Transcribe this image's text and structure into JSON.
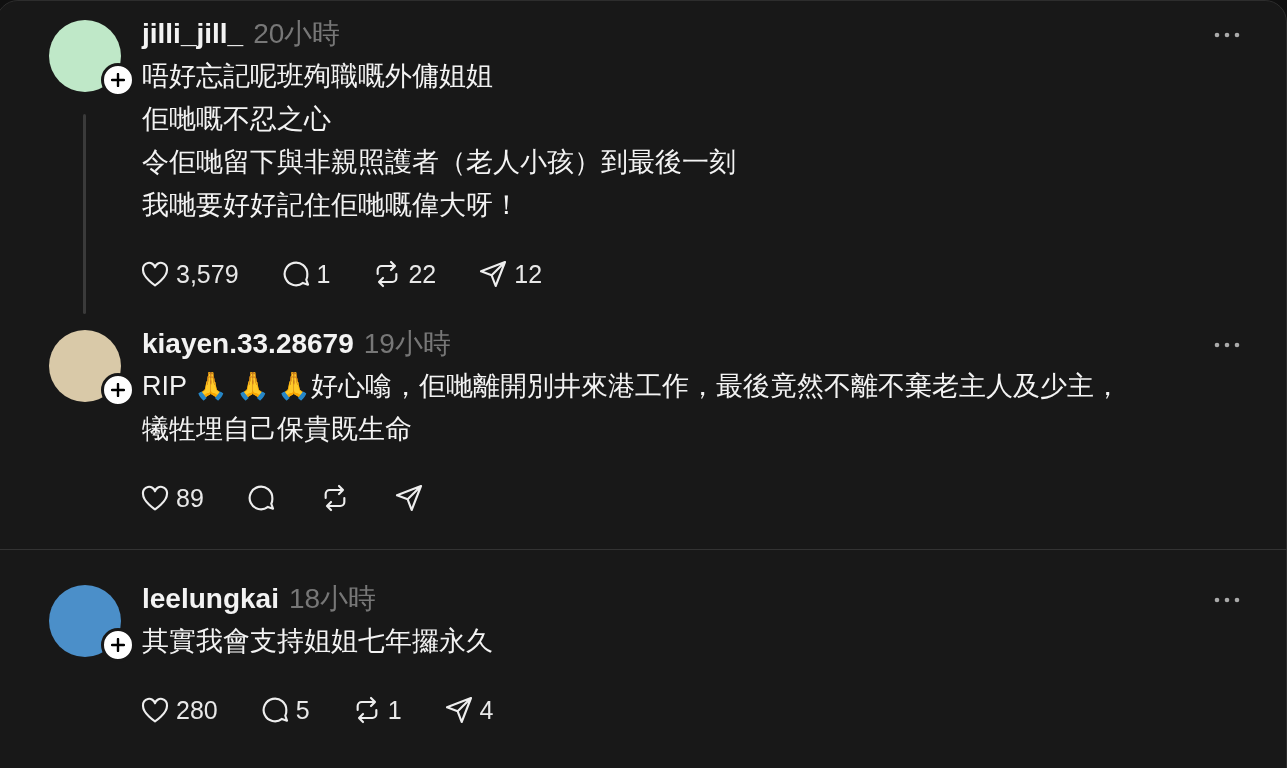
{
  "posts": [
    {
      "username": "jilli_jill_",
      "time": "20小時",
      "thread_line": true,
      "divider_below": false,
      "lines": [
        "唔好忘記呢班殉職嘅外傭姐姐",
        "佢哋嘅不忍之心",
        "令佢哋留下與非親照護者（老人小孩）到最後一刻",
        "我哋要好好記住佢哋嘅偉大呀！"
      ],
      "actions": [
        {
          "kind": "like",
          "count": "3,579"
        },
        {
          "kind": "reply",
          "count": "1"
        },
        {
          "kind": "repost",
          "count": "22"
        },
        {
          "kind": "share",
          "count": "12"
        }
      ]
    },
    {
      "username": "kiayen.33.28679",
      "time": "19小時",
      "thread_line": false,
      "divider_below": true,
      "lines": [
        "RIP 🙏 🙏 🙏好心噏，佢哋離開別井來港工作，最後竟然不離不棄老主人及少主，",
        "犧牲埋自己保貴既生命"
      ],
      "actions": [
        {
          "kind": "like",
          "count": "89"
        },
        {
          "kind": "reply"
        },
        {
          "kind": "repost"
        },
        {
          "kind": "share"
        }
      ]
    },
    {
      "username": "leelungkai",
      "time": "18小時",
      "thread_line": false,
      "divider_below": false,
      "lines": [
        "其實我會支持姐姐七年攞永久"
      ],
      "actions": [
        {
          "kind": "like",
          "count": "280"
        },
        {
          "kind": "reply",
          "count": "5"
        },
        {
          "kind": "repost",
          "count": "1"
        },
        {
          "kind": "share",
          "count": "4"
        }
      ]
    }
  ]
}
